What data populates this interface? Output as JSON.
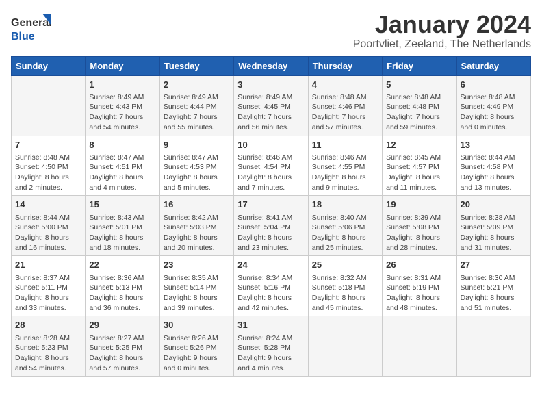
{
  "logo": {
    "general": "General",
    "blue": "Blue"
  },
  "title": "January 2024",
  "subtitle": "Poortvliet, Zeeland, The Netherlands",
  "days_header": [
    "Sunday",
    "Monday",
    "Tuesday",
    "Wednesday",
    "Thursday",
    "Friday",
    "Saturday"
  ],
  "weeks": [
    [
      {
        "day": "",
        "lines": []
      },
      {
        "day": "1",
        "lines": [
          "Sunrise: 8:49 AM",
          "Sunset: 4:43 PM",
          "Daylight: 7 hours",
          "and 54 minutes."
        ]
      },
      {
        "day": "2",
        "lines": [
          "Sunrise: 8:49 AM",
          "Sunset: 4:44 PM",
          "Daylight: 7 hours",
          "and 55 minutes."
        ]
      },
      {
        "day": "3",
        "lines": [
          "Sunrise: 8:49 AM",
          "Sunset: 4:45 PM",
          "Daylight: 7 hours",
          "and 56 minutes."
        ]
      },
      {
        "day": "4",
        "lines": [
          "Sunrise: 8:48 AM",
          "Sunset: 4:46 PM",
          "Daylight: 7 hours",
          "and 57 minutes."
        ]
      },
      {
        "day": "5",
        "lines": [
          "Sunrise: 8:48 AM",
          "Sunset: 4:48 PM",
          "Daylight: 7 hours",
          "and 59 minutes."
        ]
      },
      {
        "day": "6",
        "lines": [
          "Sunrise: 8:48 AM",
          "Sunset: 4:49 PM",
          "Daylight: 8 hours",
          "and 0 minutes."
        ]
      }
    ],
    [
      {
        "day": "7",
        "lines": [
          "Sunrise: 8:48 AM",
          "Sunset: 4:50 PM",
          "Daylight: 8 hours",
          "and 2 minutes."
        ]
      },
      {
        "day": "8",
        "lines": [
          "Sunrise: 8:47 AM",
          "Sunset: 4:51 PM",
          "Daylight: 8 hours",
          "and 4 minutes."
        ]
      },
      {
        "day": "9",
        "lines": [
          "Sunrise: 8:47 AM",
          "Sunset: 4:53 PM",
          "Daylight: 8 hours",
          "and 5 minutes."
        ]
      },
      {
        "day": "10",
        "lines": [
          "Sunrise: 8:46 AM",
          "Sunset: 4:54 PM",
          "Daylight: 8 hours",
          "and 7 minutes."
        ]
      },
      {
        "day": "11",
        "lines": [
          "Sunrise: 8:46 AM",
          "Sunset: 4:55 PM",
          "Daylight: 8 hours",
          "and 9 minutes."
        ]
      },
      {
        "day": "12",
        "lines": [
          "Sunrise: 8:45 AM",
          "Sunset: 4:57 PM",
          "Daylight: 8 hours",
          "and 11 minutes."
        ]
      },
      {
        "day": "13",
        "lines": [
          "Sunrise: 8:44 AM",
          "Sunset: 4:58 PM",
          "Daylight: 8 hours",
          "and 13 minutes."
        ]
      }
    ],
    [
      {
        "day": "14",
        "lines": [
          "Sunrise: 8:44 AM",
          "Sunset: 5:00 PM",
          "Daylight: 8 hours",
          "and 16 minutes."
        ]
      },
      {
        "day": "15",
        "lines": [
          "Sunrise: 8:43 AM",
          "Sunset: 5:01 PM",
          "Daylight: 8 hours",
          "and 18 minutes."
        ]
      },
      {
        "day": "16",
        "lines": [
          "Sunrise: 8:42 AM",
          "Sunset: 5:03 PM",
          "Daylight: 8 hours",
          "and 20 minutes."
        ]
      },
      {
        "day": "17",
        "lines": [
          "Sunrise: 8:41 AM",
          "Sunset: 5:04 PM",
          "Daylight: 8 hours",
          "and 23 minutes."
        ]
      },
      {
        "day": "18",
        "lines": [
          "Sunrise: 8:40 AM",
          "Sunset: 5:06 PM",
          "Daylight: 8 hours",
          "and 25 minutes."
        ]
      },
      {
        "day": "19",
        "lines": [
          "Sunrise: 8:39 AM",
          "Sunset: 5:08 PM",
          "Daylight: 8 hours",
          "and 28 minutes."
        ]
      },
      {
        "day": "20",
        "lines": [
          "Sunrise: 8:38 AM",
          "Sunset: 5:09 PM",
          "Daylight: 8 hours",
          "and 31 minutes."
        ]
      }
    ],
    [
      {
        "day": "21",
        "lines": [
          "Sunrise: 8:37 AM",
          "Sunset: 5:11 PM",
          "Daylight: 8 hours",
          "and 33 minutes."
        ]
      },
      {
        "day": "22",
        "lines": [
          "Sunrise: 8:36 AM",
          "Sunset: 5:13 PM",
          "Daylight: 8 hours",
          "and 36 minutes."
        ]
      },
      {
        "day": "23",
        "lines": [
          "Sunrise: 8:35 AM",
          "Sunset: 5:14 PM",
          "Daylight: 8 hours",
          "and 39 minutes."
        ]
      },
      {
        "day": "24",
        "lines": [
          "Sunrise: 8:34 AM",
          "Sunset: 5:16 PM",
          "Daylight: 8 hours",
          "and 42 minutes."
        ]
      },
      {
        "day": "25",
        "lines": [
          "Sunrise: 8:32 AM",
          "Sunset: 5:18 PM",
          "Daylight: 8 hours",
          "and 45 minutes."
        ]
      },
      {
        "day": "26",
        "lines": [
          "Sunrise: 8:31 AM",
          "Sunset: 5:19 PM",
          "Daylight: 8 hours",
          "and 48 minutes."
        ]
      },
      {
        "day": "27",
        "lines": [
          "Sunrise: 8:30 AM",
          "Sunset: 5:21 PM",
          "Daylight: 8 hours",
          "and 51 minutes."
        ]
      }
    ],
    [
      {
        "day": "28",
        "lines": [
          "Sunrise: 8:28 AM",
          "Sunset: 5:23 PM",
          "Daylight: 8 hours",
          "and 54 minutes."
        ]
      },
      {
        "day": "29",
        "lines": [
          "Sunrise: 8:27 AM",
          "Sunset: 5:25 PM",
          "Daylight: 8 hours",
          "and 57 minutes."
        ]
      },
      {
        "day": "30",
        "lines": [
          "Sunrise: 8:26 AM",
          "Sunset: 5:26 PM",
          "Daylight: 9 hours",
          "and 0 minutes."
        ]
      },
      {
        "day": "31",
        "lines": [
          "Sunrise: 8:24 AM",
          "Sunset: 5:28 PM",
          "Daylight: 9 hours",
          "and 4 minutes."
        ]
      },
      {
        "day": "",
        "lines": []
      },
      {
        "day": "",
        "lines": []
      },
      {
        "day": "",
        "lines": []
      }
    ]
  ]
}
